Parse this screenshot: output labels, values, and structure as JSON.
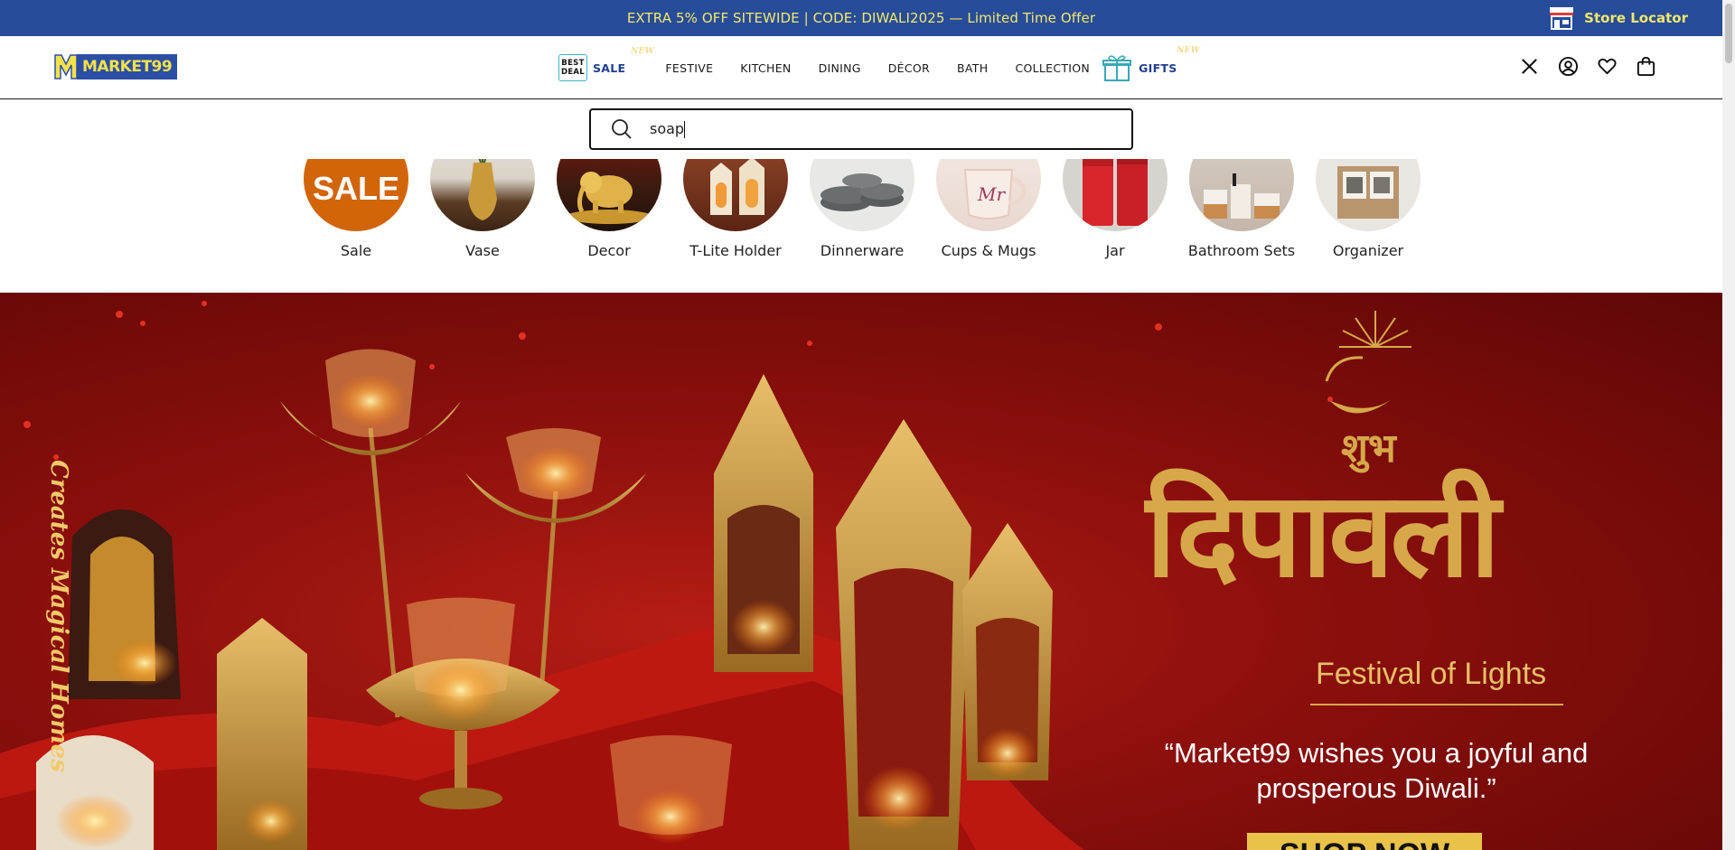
{
  "announcement": {
    "text": "EXTRA 5% OFF SITEWIDE | CODE: DIWALI2025 — Limited Time Offer",
    "store_locator": "Store Locator"
  },
  "header": {
    "logo_text": "MARKET99",
    "nav": {
      "sale_badge_line1": "BEST",
      "sale_badge_line2": "DEAL",
      "sale": "SALE",
      "sale_new": "NEW",
      "items": [
        "FESTIVE",
        "KITCHEN",
        "DINING",
        "DÉCOR",
        "BATH",
        "COLLECTION"
      ],
      "gifts": "GIFTS",
      "gifts_new": "NEW"
    },
    "icons": [
      "close-icon",
      "account-icon",
      "wishlist-icon",
      "cart-icon"
    ]
  },
  "search": {
    "value": "soap"
  },
  "categories": [
    {
      "label": "Sale",
      "badge": "SALE"
    },
    {
      "label": "Vase"
    },
    {
      "label": "Decor"
    },
    {
      "label": "T-Lite Holder"
    },
    {
      "label": "Dinnerware"
    },
    {
      "label": "Cups & Mugs"
    },
    {
      "label": "Jar"
    },
    {
      "label": "Bathroom Sets"
    },
    {
      "label": "Organizer"
    }
  ],
  "hero": {
    "vertical_text": "Creates Magical Homes",
    "shubh": "शुभ",
    "deepawali": "दिपावली",
    "festival": "Festival of Lights",
    "wish": "“Market99 wishes you a joyful and prosperous Diwali.”",
    "cta": "SHOP NOW"
  },
  "colors": {
    "announce_bg": "#264c9a",
    "announce_text": "#f5e76a",
    "brand_blue": "#2b4fa5",
    "hero_red": "#8a0f0c",
    "gold": "#d6a84a"
  }
}
